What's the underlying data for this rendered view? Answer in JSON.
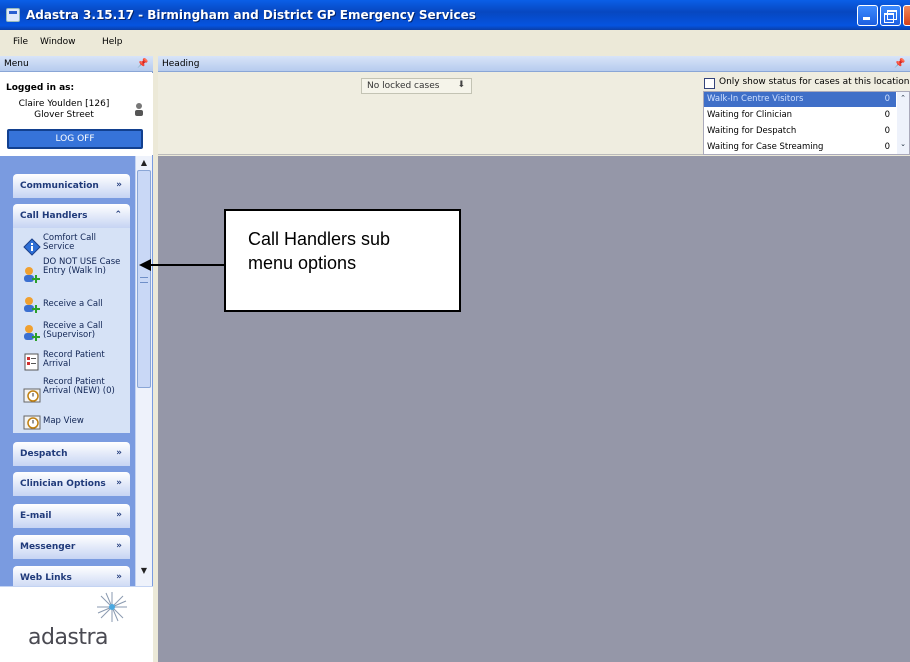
{
  "window": {
    "title": "Adastra 3.15.17 - Birmingham and District GP Emergency Services"
  },
  "menubar": {
    "file": "File",
    "window": "Window",
    "help": "Help"
  },
  "left_panel": {
    "header": "Menu",
    "logged_in_label": "Logged in as:",
    "user_name": "Claire Youlden [126]",
    "user_location": "Glover Street",
    "logoff_label": "LOG OFF",
    "sections": [
      {
        "label": "Communication"
      },
      {
        "label": "Call Handlers"
      },
      {
        "label": "Despatch"
      },
      {
        "label": "Clinician Options"
      },
      {
        "label": "E-mail"
      },
      {
        "label": "Messenger"
      },
      {
        "label": "Web Links"
      }
    ],
    "call_handler_items": [
      {
        "label": "Comfort Call Service",
        "icon": "info-diamond-icon"
      },
      {
        "label": "DO NOT USE Case Entry (Walk In)",
        "icon": "add-user-icon"
      },
      {
        "label": "Receive a Call",
        "icon": "add-user-icon"
      },
      {
        "label": "Receive a Call (Supervisor)",
        "icon": "add-user-icon"
      },
      {
        "label": "Record Patient Arrival",
        "icon": "checklist-icon"
      },
      {
        "label": "Record Patient Arrival (NEW) (0)",
        "icon": "clock-icon"
      },
      {
        "label": "Map View",
        "icon": "clock-icon"
      }
    ],
    "logo_text": "adastra"
  },
  "main": {
    "header": "Heading",
    "locked_cases": "No locked cases",
    "status_filter_label": "Only show status for cases at this location",
    "status_rows": [
      {
        "name": "Walk-In Centre Visitors",
        "count": "0"
      },
      {
        "name": "Waiting for Clinician",
        "count": "0"
      },
      {
        "name": "Waiting for Despatch",
        "count": "0"
      },
      {
        "name": "Waiting for Case Streaming",
        "count": "0"
      }
    ]
  },
  "callout": {
    "line1": "Call Handlers sub",
    "line2": "menu options"
  }
}
